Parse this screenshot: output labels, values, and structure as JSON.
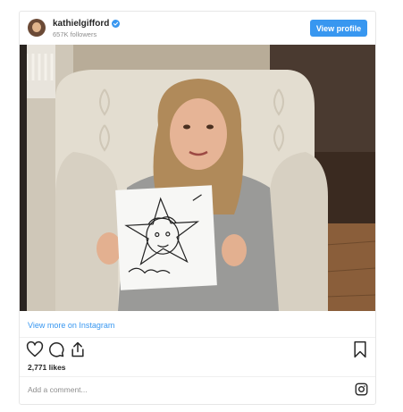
{
  "header": {
    "username": "kathielgifford",
    "followers": "657K followers",
    "view_profile_label": "View profile"
  },
  "post": {
    "view_more_label": "View more on Instagram",
    "likes": "2,771 likes",
    "comment_placeholder": "Add a comment..."
  },
  "colors": {
    "accent": "#3897f0",
    "text": "#262626",
    "muted": "#8e8e8e"
  },
  "icons": [
    "verified-badge-icon",
    "heart-icon",
    "comment-icon",
    "share-icon",
    "bookmark-icon",
    "instagram-icon"
  ]
}
